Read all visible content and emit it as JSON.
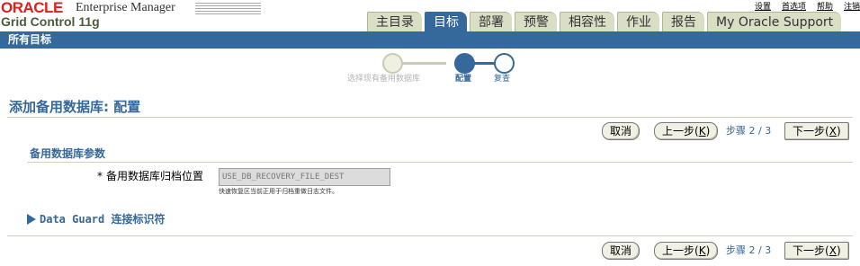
{
  "brand": {
    "logo": "ORACLE",
    "product": "Enterprise Manager",
    "subtitle": "Grid Control 11g"
  },
  "global_links": [
    "设置",
    "首选项",
    "帮助",
    "注销"
  ],
  "tabs": [
    {
      "label": "主目录",
      "active": false
    },
    {
      "label": "目标",
      "active": true
    },
    {
      "label": "部署",
      "active": false
    },
    {
      "label": "预警",
      "active": false
    },
    {
      "label": "相容性",
      "active": false
    },
    {
      "label": "作业",
      "active": false
    },
    {
      "label": "报告",
      "active": false
    },
    {
      "label": "My Oracle Support",
      "active": false
    }
  ],
  "header_bar": {
    "label": "所有目标"
  },
  "train": {
    "steps": [
      {
        "label": "选择现有备用数据库",
        "state": "visited"
      },
      {
        "label": "配置",
        "state": "current"
      },
      {
        "label": "复查",
        "state": "next"
      }
    ]
  },
  "page_title": "添加备用数据库: 配置",
  "buttons": {
    "cancel": "取消",
    "back": "上一步",
    "back_key": "K",
    "next": "下一步",
    "next_key": "X",
    "step_text": "步骤 2 / 3"
  },
  "section": {
    "title": "备用数据库参数",
    "field_label": "备用数据库归档位置",
    "required_mark": "*",
    "field_value": "USE_DB_RECOVERY_FILE_DEST",
    "field_hint": "快速恢复区当前正用于归档重做日志文件。"
  },
  "disclosure": {
    "label": "Data Guard 连接标识符",
    "expanded": false
  },
  "colors": {
    "accent": "#35689b",
    "tab_bg": "#d9dec4",
    "brand_red": "#e0201a"
  }
}
